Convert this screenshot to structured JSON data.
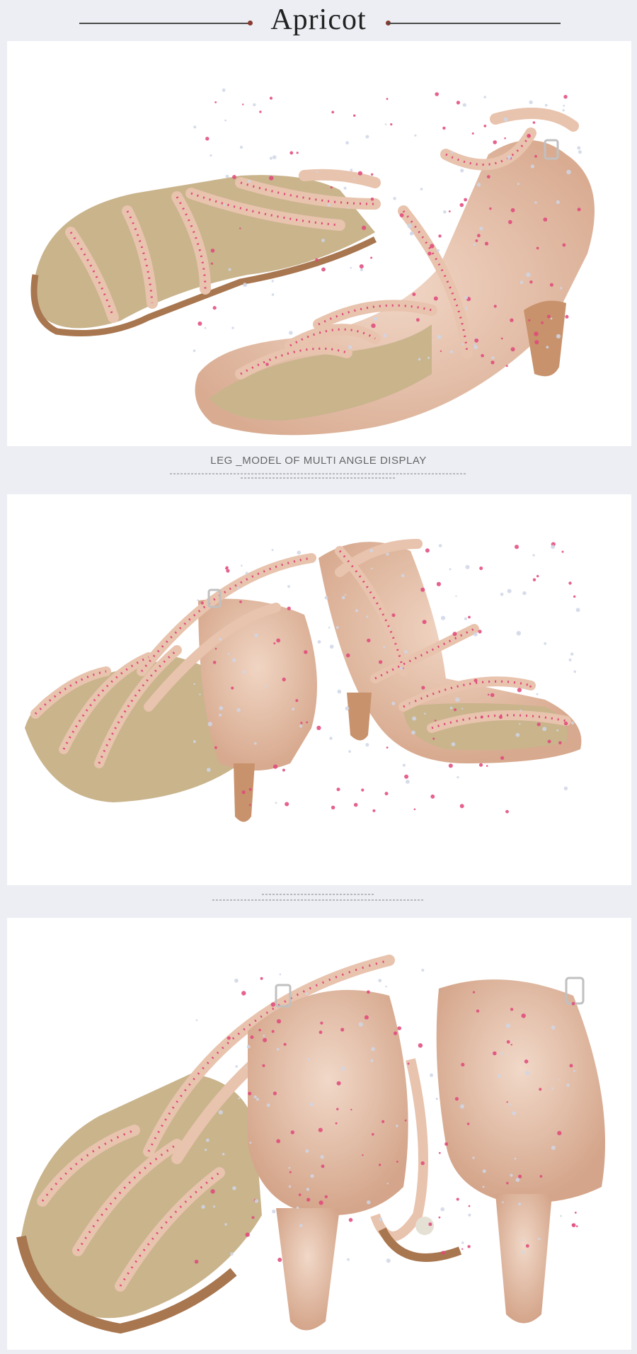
{
  "header": {
    "title": "Apricot"
  },
  "caption": "LEG _MODEL OF MULTI ANGLE DISPLAY",
  "panels": [
    {
      "alt": "two apricot rhinestone dance sandals, side view"
    },
    {
      "alt": "two apricot rhinestone dance sandals, back and front view"
    },
    {
      "alt": "two apricot rhinestone dance sandals, rear heel close-up"
    }
  ],
  "colors": {
    "satin": "#e8c3ad",
    "satin_dark": "#d4a88f",
    "insole": "#c9b48c",
    "sole": "#a8764f",
    "rhinestone_pink": "#e0467a",
    "rhinestone_silver": "#cfd6e6"
  }
}
